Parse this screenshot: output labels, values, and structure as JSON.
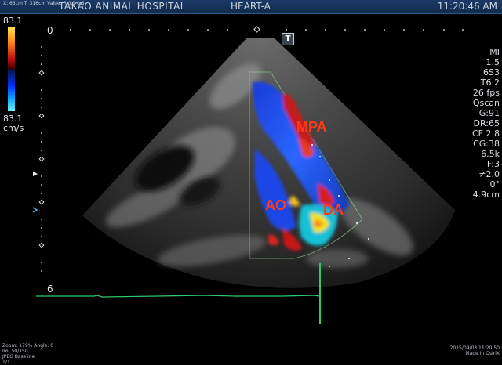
{
  "header": {
    "probe_info": "X: 63cm T: 316cm Value: R:0.9 0.8",
    "hospital": "TAKAO ANIMAL HOSPITAL",
    "preset": "HEART-A",
    "time": "11:20:46 AM"
  },
  "color_scale": {
    "top_value": "83.1",
    "bottom_value": "83.1",
    "unit": "cm/s"
  },
  "depth": {
    "start": "0",
    "end": "6"
  },
  "labels": {
    "mpa": "MPA",
    "ao": "AO",
    "da": "DA"
  },
  "toolbar": {
    "t_button": "T"
  },
  "params": {
    "mi": "MI",
    "mi_value": "1.5",
    "probe": "6S3",
    "preset_code": "T6.2",
    "fps": "26 fps",
    "mode": "Qscan",
    "gain": "G:91",
    "dr": "DR:65",
    "cf": "CF 2.8",
    "cg": "CG:38",
    "prf": "6.5k",
    "filter": "F:3",
    "angle_icon_text": "2.0",
    "angle": "0°",
    "depth_cm": "4.9cm"
  },
  "footer": {
    "zoom": "Zoom: 179% Angle: 0",
    "frames": "Im: 50/150",
    "baseline": "JPEG Baseline",
    "count": "1/1",
    "date": "2015/09/03 11:20:50",
    "made_in": "Made In OsiriX"
  },
  "colors": {
    "header_bg": "#1c3a66",
    "label_red": "#ff3a1a",
    "doppler_blue": "#1a4cff",
    "doppler_red": "#d01818",
    "ecg_green": "#2ecc71"
  }
}
